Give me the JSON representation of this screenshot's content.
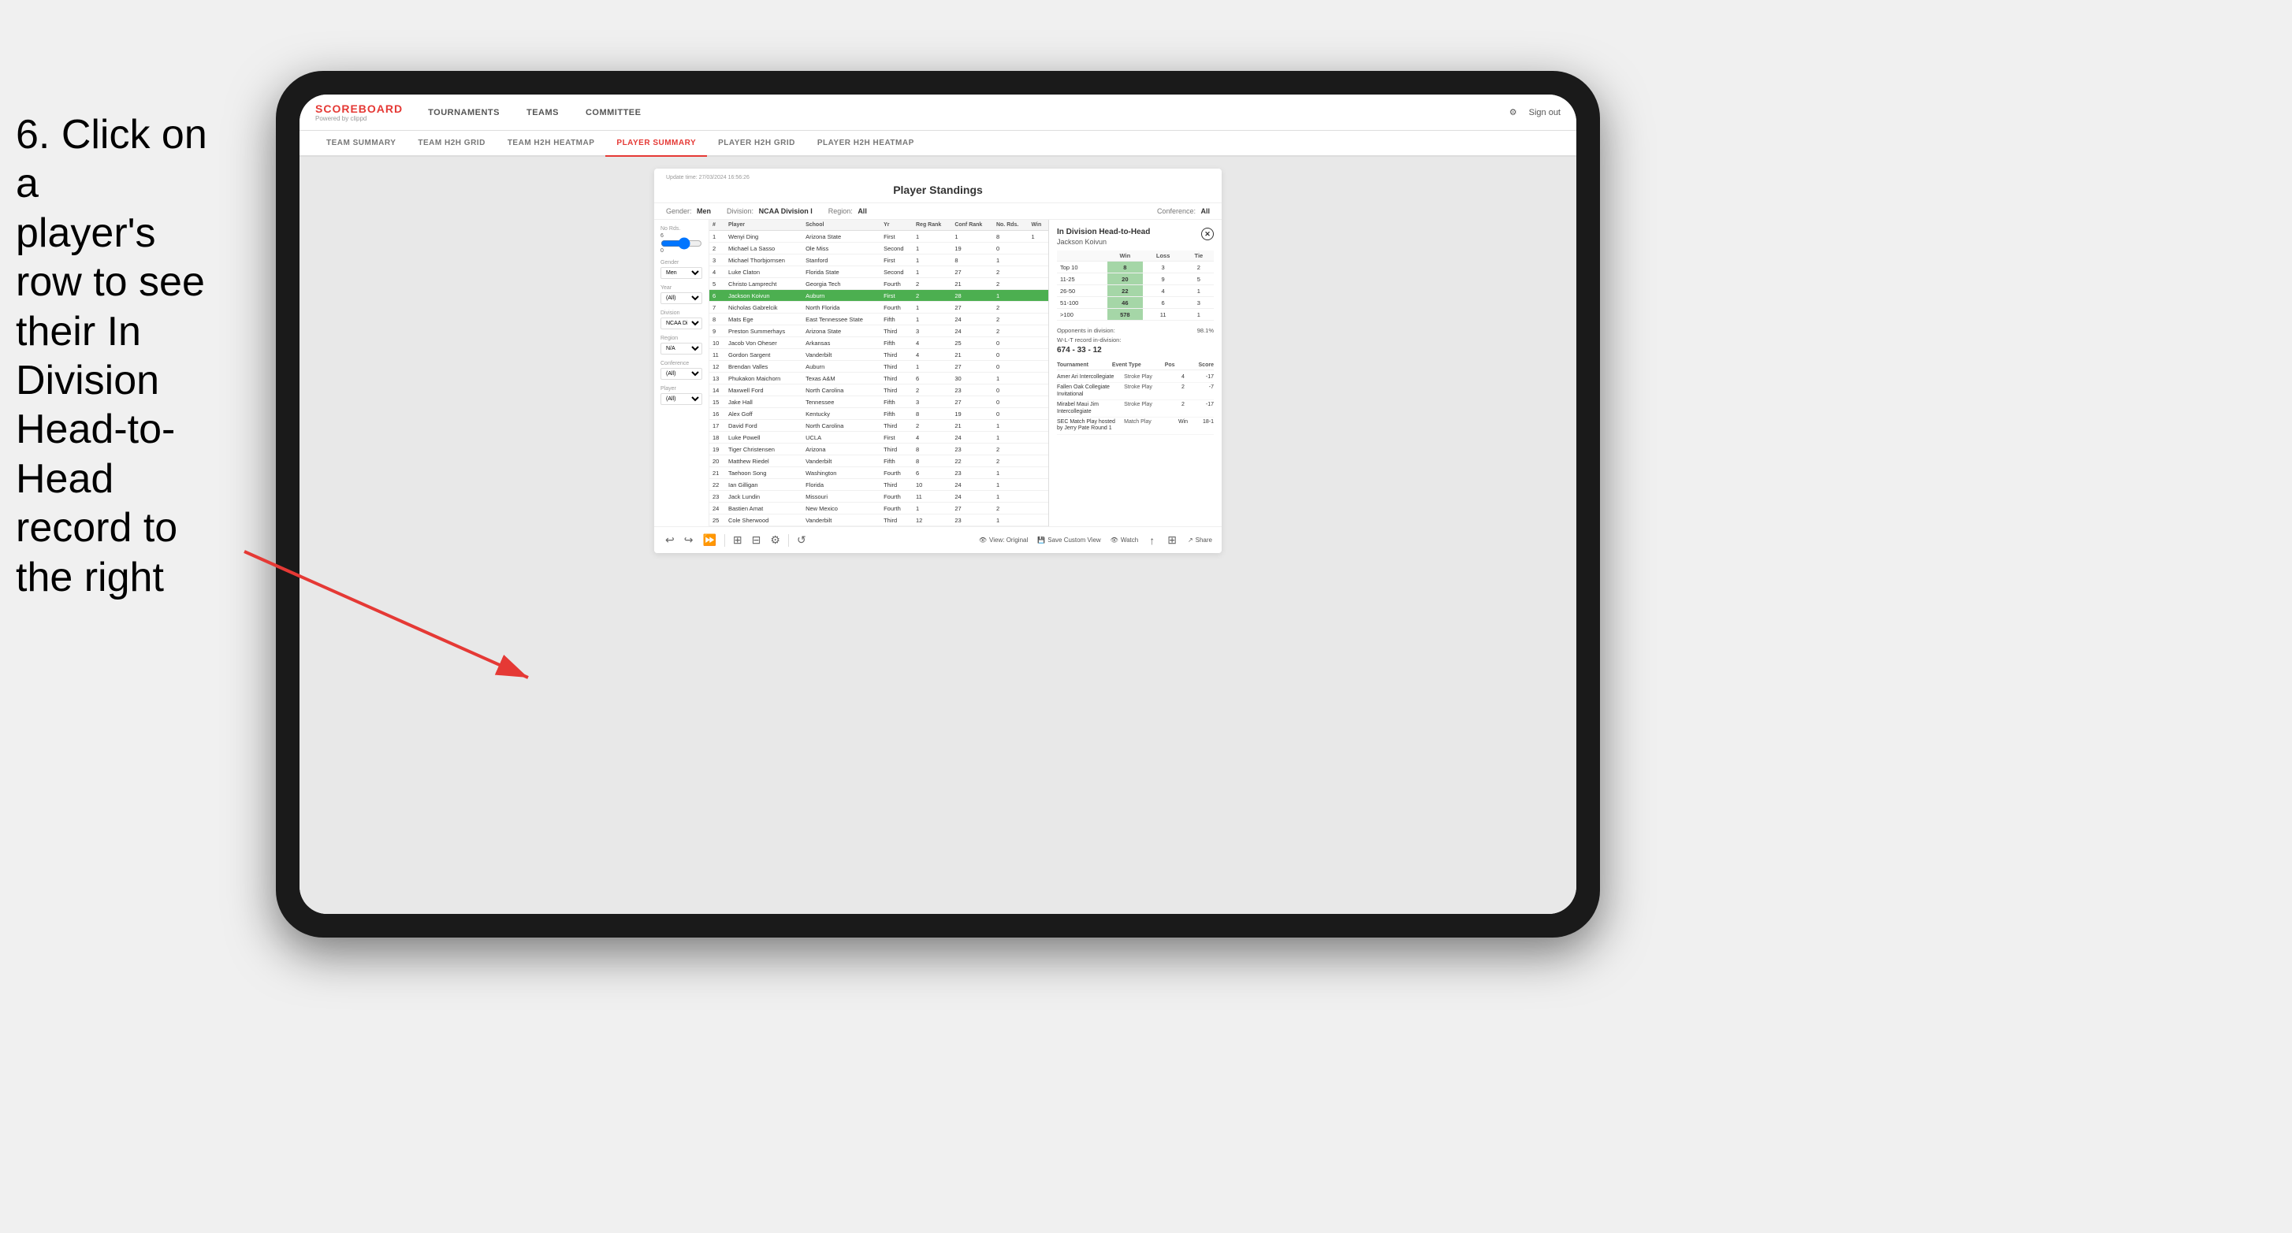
{
  "instruction": {
    "line1": "6. Click on a",
    "line2": "player's row to see",
    "line3": "their In Division",
    "line4": "Head-to-Head",
    "line5": "record to the right"
  },
  "nav": {
    "logo": "SCOREBOARD",
    "powered_by": "Powered by clippd",
    "items": [
      "TOURNAMENTS",
      "TEAMS",
      "COMMITTEE"
    ],
    "sign_out": "Sign out"
  },
  "sub_nav": {
    "items": [
      "TEAM SUMMARY",
      "TEAM H2H GRID",
      "TEAM H2H HEATMAP",
      "PLAYER SUMMARY",
      "PLAYER H2H GRID",
      "PLAYER H2H HEATMAP"
    ],
    "active": "PLAYER SUMMARY"
  },
  "card": {
    "update_time": "Update time: 27/03/2024 16:56:26",
    "title": "Player Standings",
    "filters": {
      "gender": "Men",
      "division": "NCAA Division I",
      "region": "All",
      "conference": "All"
    }
  },
  "left_filters": {
    "no_rds_label": "No Rds.",
    "no_rds_value": "6",
    "slider_value": "0",
    "gender_label": "Gender",
    "gender_value": "Men",
    "year_label": "Year",
    "year_value": "(All)",
    "division_label": "Division",
    "division_value": "NCAA Division I",
    "region_label": "Region",
    "region_value": "N/A",
    "conference_label": "Conference",
    "conference_value": "(All)",
    "player_label": "Player",
    "player_value": "(All)"
  },
  "table": {
    "headers": [
      "#",
      "Player",
      "School",
      "Yr",
      "Reg Rank",
      "Conf Rank",
      "No Rds.",
      "Win"
    ],
    "rows": [
      {
        "rank": "1",
        "player": "Wenyi Ding",
        "school": "Arizona State",
        "yr": "First",
        "reg": "1",
        "conf": "1",
        "rds": "8",
        "win": "1"
      },
      {
        "rank": "2",
        "player": "Michael La Sasso",
        "school": "Ole Miss",
        "yr": "Second",
        "reg": "1",
        "conf": "19",
        "rds": "0",
        "win": ""
      },
      {
        "rank": "3",
        "player": "Michael Thorbjornsen",
        "school": "Stanford",
        "yr": "First",
        "reg": "1",
        "conf": "8",
        "rds": "1",
        "win": ""
      },
      {
        "rank": "4",
        "player": "Luke Claton",
        "school": "Florida State",
        "yr": "Second",
        "reg": "1",
        "conf": "27",
        "rds": "2",
        "win": ""
      },
      {
        "rank": "5",
        "player": "Christo Lamprecht",
        "school": "Georgia Tech",
        "yr": "Fourth",
        "reg": "2",
        "conf": "21",
        "rds": "2",
        "win": ""
      },
      {
        "rank": "6",
        "player": "Jackson Koivun",
        "school": "Auburn",
        "yr": "First",
        "reg": "2",
        "conf": "28",
        "rds": "1",
        "win": "",
        "highlighted": true
      },
      {
        "rank": "7",
        "player": "Nicholas Gabrelcik",
        "school": "North Florida",
        "yr": "Fourth",
        "reg": "1",
        "conf": "27",
        "rds": "2",
        "win": ""
      },
      {
        "rank": "8",
        "player": "Mats Ege",
        "school": "East Tennessee State",
        "yr": "Fifth",
        "reg": "1",
        "conf": "24",
        "rds": "2",
        "win": ""
      },
      {
        "rank": "9",
        "player": "Preston Summerhays",
        "school": "Arizona State",
        "yr": "Third",
        "reg": "3",
        "conf": "24",
        "rds": "2",
        "win": ""
      },
      {
        "rank": "10",
        "player": "Jacob Von Oheser",
        "school": "Arkansas",
        "yr": "Fifth",
        "reg": "4",
        "conf": "25",
        "rds": "0",
        "win": ""
      },
      {
        "rank": "11",
        "player": "Gordon Sargent",
        "school": "Vanderbilt",
        "yr": "Third",
        "reg": "4",
        "conf": "21",
        "rds": "0",
        "win": ""
      },
      {
        "rank": "12",
        "player": "Brendan Valles",
        "school": "Auburn",
        "yr": "Third",
        "reg": "1",
        "conf": "27",
        "rds": "0",
        "win": ""
      },
      {
        "rank": "13",
        "player": "Phukakon Maichorn",
        "school": "Texas A&M",
        "yr": "Third",
        "reg": "6",
        "conf": "30",
        "rds": "1",
        "win": ""
      },
      {
        "rank": "14",
        "player": "Maxwell Ford",
        "school": "North Carolina",
        "yr": "Third",
        "reg": "2",
        "conf": "23",
        "rds": "0",
        "win": ""
      },
      {
        "rank": "15",
        "player": "Jake Hall",
        "school": "Tennessee",
        "yr": "Fifth",
        "reg": "3",
        "conf": "27",
        "rds": "0",
        "win": ""
      },
      {
        "rank": "16",
        "player": "Alex Goff",
        "school": "Kentucky",
        "yr": "Fifth",
        "reg": "8",
        "conf": "19",
        "rds": "0",
        "win": ""
      },
      {
        "rank": "17",
        "player": "David Ford",
        "school": "North Carolina",
        "yr": "Third",
        "reg": "2",
        "conf": "21",
        "rds": "1",
        "win": ""
      },
      {
        "rank": "18",
        "player": "Luke Powell",
        "school": "UCLA",
        "yr": "First",
        "reg": "4",
        "conf": "24",
        "rds": "1",
        "win": ""
      },
      {
        "rank": "19",
        "player": "Tiger Christensen",
        "school": "Arizona",
        "yr": "Third",
        "reg": "8",
        "conf": "23",
        "rds": "2",
        "win": ""
      },
      {
        "rank": "20",
        "player": "Matthew Riedel",
        "school": "Vanderbilt",
        "yr": "Fifth",
        "reg": "8",
        "conf": "22",
        "rds": "2",
        "win": ""
      },
      {
        "rank": "21",
        "player": "Taehoon Song",
        "school": "Washington",
        "yr": "Fourth",
        "reg": "6",
        "conf": "23",
        "rds": "1",
        "win": ""
      },
      {
        "rank": "22",
        "player": "Ian Gilligan",
        "school": "Florida",
        "yr": "Third",
        "reg": "10",
        "conf": "24",
        "rds": "1",
        "win": ""
      },
      {
        "rank": "23",
        "player": "Jack Lundin",
        "school": "Missouri",
        "yr": "Fourth",
        "reg": "11",
        "conf": "24",
        "rds": "1",
        "win": ""
      },
      {
        "rank": "24",
        "player": "Bastien Amat",
        "school": "New Mexico",
        "yr": "Fourth",
        "reg": "1",
        "conf": "27",
        "rds": "2",
        "win": ""
      },
      {
        "rank": "25",
        "player": "Cole Sherwood",
        "school": "Vanderbilt",
        "yr": "Third",
        "reg": "12",
        "conf": "23",
        "rds": "1",
        "win": ""
      }
    ]
  },
  "h2h": {
    "title": "In Division Head-to-Head",
    "player": "Jackson Koivun",
    "table_headers": [
      "",
      "Win",
      "Loss",
      "Tie"
    ],
    "rows": [
      {
        "label": "Top 10",
        "win": "8",
        "loss": "3",
        "tie": "2",
        "win_highlighted": true
      },
      {
        "label": "11-25",
        "win": "20",
        "loss": "9",
        "tie": "5",
        "win_highlighted": true
      },
      {
        "label": "26-50",
        "win": "22",
        "loss": "4",
        "tie": "1",
        "win_highlighted": true
      },
      {
        "label": "51-100",
        "win": "46",
        "loss": "6",
        "tie": "3",
        "win_highlighted": true
      },
      {
        "label": ">100",
        "win": "578",
        "loss": "11",
        "tie": "1",
        "win_highlighted": true
      }
    ],
    "opponents_label": "Opponents in division:",
    "wlt_label": "W-L-T record in-division:",
    "opponents_pct": "98.1%",
    "wlt": "674 - 33 - 12",
    "tournament_headers": [
      "Tournament",
      "Event Type",
      "Pos",
      "Score"
    ],
    "tournaments": [
      {
        "name": "Amer Ari Intercollegiate",
        "type": "Stroke Play",
        "pos": "4",
        "score": "-17"
      },
      {
        "name": "Fallen Oak Collegiate Invitational",
        "type": "Stroke Play",
        "pos": "2",
        "score": "-7"
      },
      {
        "name": "Mirabel Maui Jim Intercollegiate",
        "type": "Stroke Play",
        "pos": "2",
        "score": "-17"
      },
      {
        "name": "SEC Match Play hosted by Jerry Pate Round 1",
        "type": "Match Play",
        "pos": "Win",
        "score": "18-1"
      }
    ]
  },
  "toolbar": {
    "view_original": "View: Original",
    "save_custom": "Save Custom View",
    "watch": "Watch",
    "share": "Share"
  }
}
